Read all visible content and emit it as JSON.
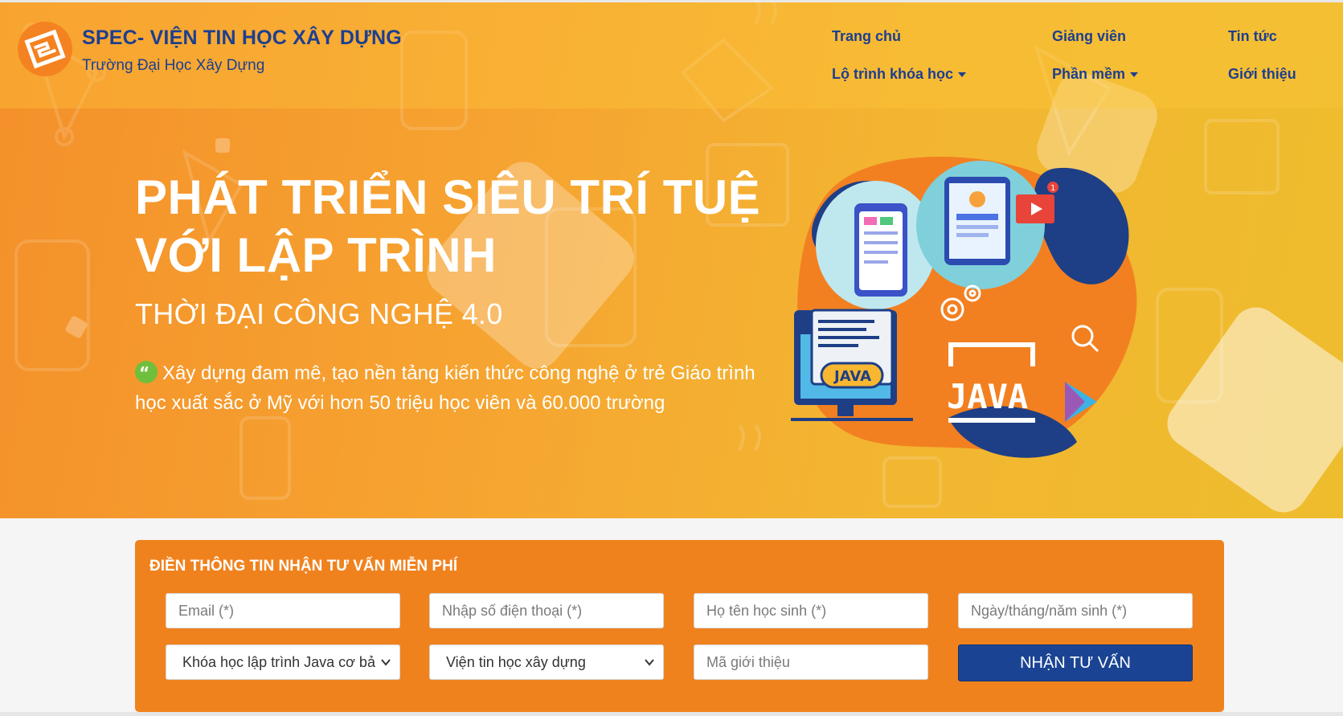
{
  "header": {
    "brand_title": "SPEC- VIỆN TIN HỌC XÂY DỰNG",
    "brand_subtitle": "Trường Đại Học Xây Dựng",
    "nav": {
      "home": "Trang chủ",
      "teachers": "Giảng viên",
      "news": "Tin tức",
      "roadmap": "Lộ trình khóa học",
      "software": "Phần mềm",
      "about": "Giới thiệu"
    }
  },
  "hero": {
    "headline_line1": "PHÁT TRIỂN SIÊU TRÍ TUỆ",
    "headline_line2": "VỚI LẬP TRÌNH",
    "subheadline": "THỜI ĐẠI CÔNG NGHỆ 4.0",
    "description": "Xây dựng đam mê, tạo nền tảng kiến thức công nghệ ở trẻ Giáo trình học xuất sắc ở Mỹ với hơn 50 triệu học viên và 60.000 trường",
    "illustration_text_1": "JAVA",
    "illustration_text_2": "JAVA",
    "illustration_badge": "1"
  },
  "form": {
    "title": "ĐIỀN THÔNG TIN NHẬN TƯ VẤN MIỄN PHÍ",
    "email_placeholder": "Email (*)",
    "phone_placeholder": "Nhập số điện thoại (*)",
    "name_placeholder": "Họ tên học sinh (*)",
    "dob_placeholder": "Ngày/tháng/năm sinh (*)",
    "course_selected": "Khóa học lập trình Java cơ bả",
    "center_selected": "Viện tin học xây dựng",
    "referral_placeholder": "Mã giới thiệu",
    "submit_label": "NHẬN TƯ VẤN"
  },
  "colors": {
    "brand_blue": "#1d3f8f",
    "hero_orange": "#f4902a",
    "hero_yellow": "#eebd2d",
    "form_orange": "#f0821e",
    "button_blue": "#1a4493"
  },
  "icons": [
    "logo-icon",
    "quote-icon",
    "chevron-down-icon",
    "java-monitor-icon",
    "phone-app-icon",
    "tablet-video-icon",
    "gear-icon",
    "search-icon",
    "play-store-icon"
  ]
}
